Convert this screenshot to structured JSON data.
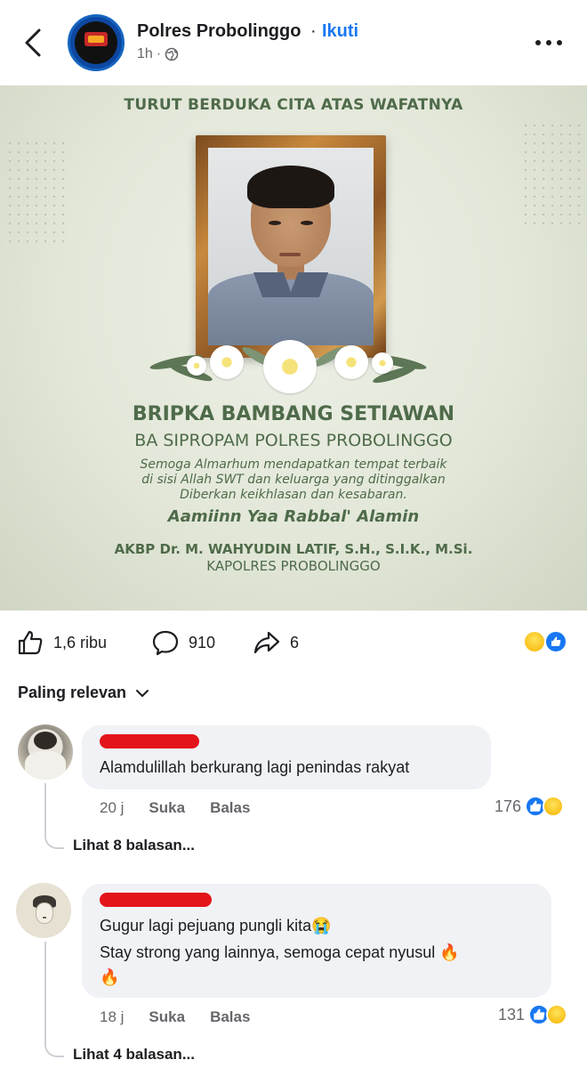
{
  "header": {
    "page_name": "Polres Probolinggo",
    "separator": "·",
    "follow_label": "Ikuti",
    "time": "1h",
    "separator2": "·",
    "privacy_icon": "globe-icon"
  },
  "post_image": {
    "title": "TURUT BERDUKA CITA ATAS WAFATNYA",
    "name": "BRIPKA BAMBANG SETIAWAN",
    "unit": "BA SIPROPAM POLRES PROBOLINGGO",
    "prayer_line1": "Semoga Almarhum mendapatkan tempat terbaik",
    "prayer_line2": "di sisi Allah SWT dan keluarga yang ditinggalkan",
    "prayer_line3": "Diberkan keikhlasan dan kesabaran.",
    "amin": "Aamiinn Yaa Rabbal' Alamin",
    "signer": "AKBP Dr. M. WAHYUDIN LATIF, S.H., S.I.K., M.Si.",
    "signer_title": "KAPOLRES PROBOLINGGO"
  },
  "actions": {
    "likes": "1,6 ribu",
    "comments": "910",
    "shares": "6",
    "reactions": [
      "haha-emoji-icon",
      "like-reaction-icon"
    ]
  },
  "sort": {
    "label": "Paling relevan"
  },
  "comments": [
    {
      "text": "Alamdulillah berkurang lagi penindas rakyat",
      "time": "20 j",
      "like_label": "Suka",
      "reply_label": "Balas",
      "reaction_count": "176",
      "view_replies": "Lihat 8 balasan..."
    },
    {
      "text_line1": "Gugur lagi pejuang pungli kita😭",
      "text_line2": "Stay strong yang lainnya, semoga cepat nyusul 🔥",
      "text_line3": "🔥",
      "time": "18 j",
      "like_label": "Suka",
      "reply_label": "Balas",
      "reaction_count": "131",
      "view_replies": "Lihat 4 balasan..."
    }
  ],
  "colors": {
    "accent": "#1877f2",
    "muted": "#65676b",
    "bubble": "#f0f2f5",
    "image_text": "#4f6b4a",
    "redaction": "#e4141b"
  }
}
